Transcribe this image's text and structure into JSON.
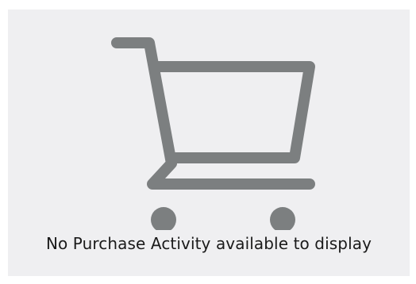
{
  "empty_state": {
    "icon": "shopping-cart-icon",
    "icon_color": "#7c7f80",
    "background": "#efeff1",
    "message": "No Purchase Activity available to display"
  }
}
